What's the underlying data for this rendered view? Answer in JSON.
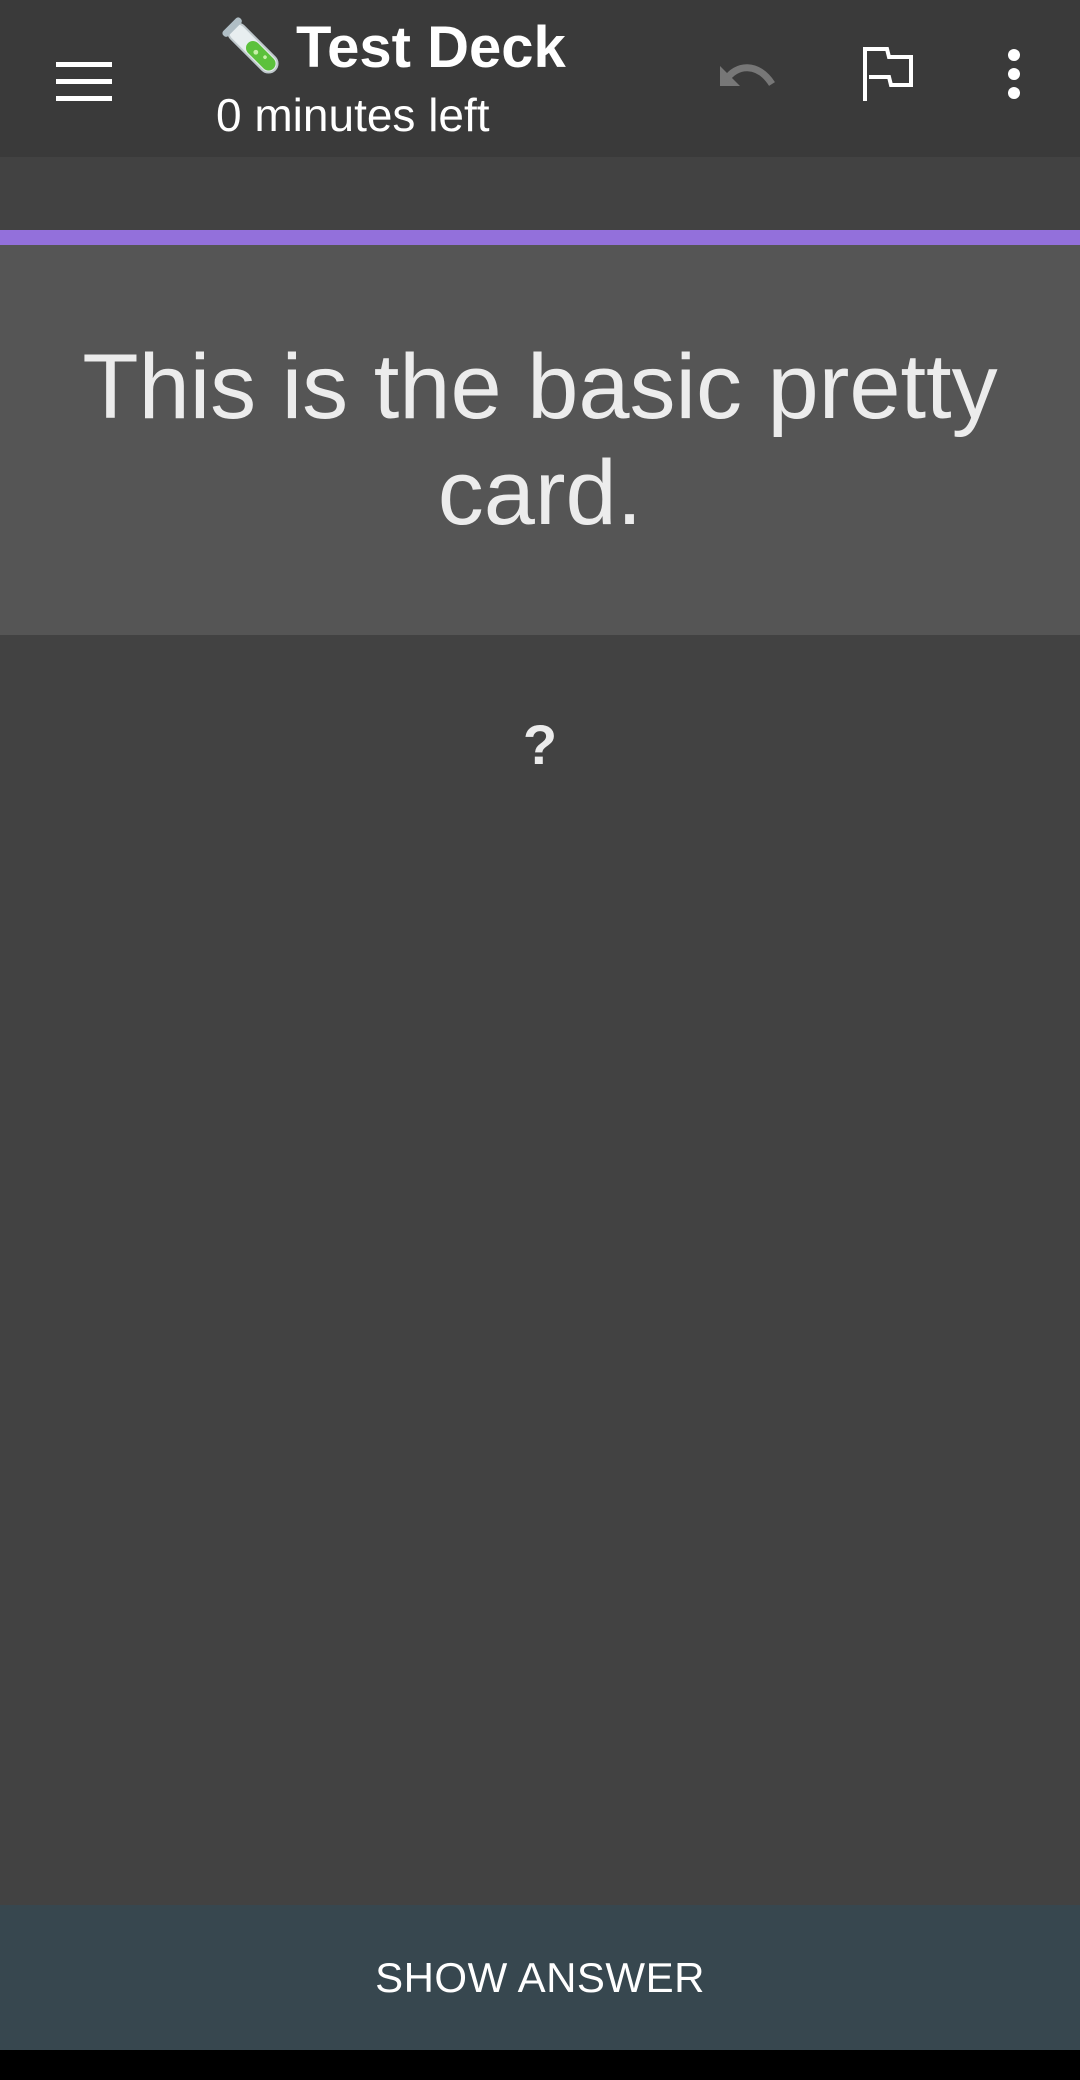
{
  "toolbar": {
    "deck_icon": "test-tube-emoji",
    "title": "Test Deck",
    "subtitle": "0 minutes left",
    "icons": {
      "menu": "hamburger-menu-icon",
      "undo": "undo-icon",
      "flag": "flag-icon",
      "more": "more-vert-icon"
    }
  },
  "card": {
    "question": "This is the basic pretty card.",
    "placeholder": "?",
    "accent_color": "#9370db"
  },
  "footer": {
    "show_answer_label": "SHOW ANSWER"
  },
  "colors": {
    "toolbar_bg": "#3a3a3a",
    "screen_bg": "#424242",
    "card_bg": "#555555",
    "answer_button_bg": "#37474f",
    "undo_disabled": "#777777"
  }
}
